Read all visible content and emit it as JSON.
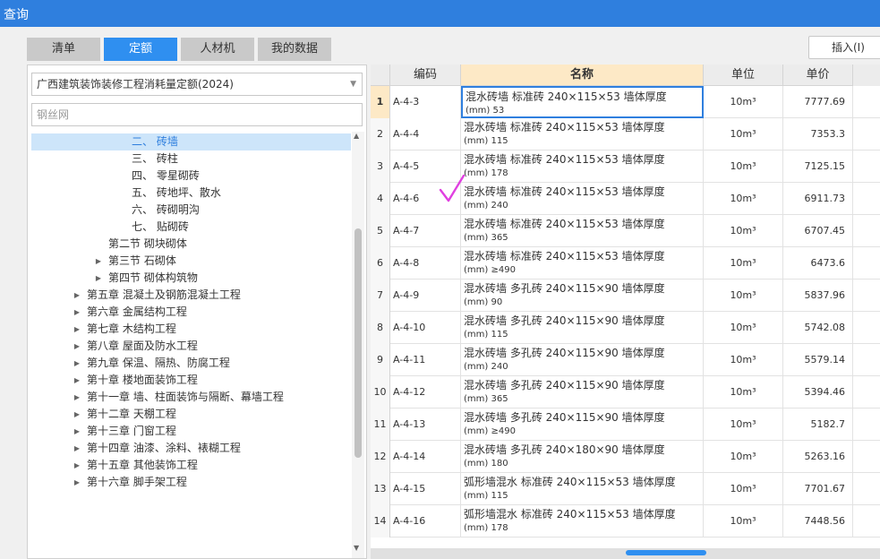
{
  "window": {
    "title": "查询"
  },
  "tabs": [
    {
      "label": "清单",
      "active": false
    },
    {
      "label": "定额",
      "active": true
    },
    {
      "label": "人材机",
      "active": false
    },
    {
      "label": "我的数据",
      "active": false
    }
  ],
  "insert_button": "插入(I)",
  "quota_library": {
    "selected": "广西建筑装饰装修工程消耗量定额(2024)"
  },
  "search": {
    "value": "钢丝网"
  },
  "tree": [
    {
      "label": "二、 砖墙",
      "selected": true,
      "caret": ""
    },
    {
      "label": "三、 砖柱",
      "selected": false,
      "caret": ""
    },
    {
      "label": "四、 零星砌砖",
      "selected": false,
      "caret": ""
    },
    {
      "label": "五、 砖地坪、散水",
      "selected": false,
      "caret": ""
    },
    {
      "label": "六、 砖砌明沟",
      "selected": false,
      "caret": ""
    },
    {
      "label": "七、 贴砌砖",
      "selected": false,
      "caret": ""
    },
    {
      "label": "第二节 砌块砌体",
      "selected": false,
      "caret": ""
    },
    {
      "label": "第三节 石砌体",
      "selected": false,
      "caret": "▶"
    },
    {
      "label": "第四节 砌体构筑物",
      "selected": false,
      "caret": "▶"
    },
    {
      "label": "第五章 混凝土及钢筋混凝土工程",
      "selected": false,
      "caret": "▶"
    },
    {
      "label": "第六章 金属结构工程",
      "selected": false,
      "caret": "▶"
    },
    {
      "label": "第七章 木结构工程",
      "selected": false,
      "caret": "▶"
    },
    {
      "label": "第八章 屋面及防水工程",
      "selected": false,
      "caret": "▶"
    },
    {
      "label": "第九章 保温、隔热、防腐工程",
      "selected": false,
      "caret": "▶"
    },
    {
      "label": "第十章 楼地面装饰工程",
      "selected": false,
      "caret": "▶"
    },
    {
      "label": "第十一章 墙、柱面装饰与隔断、幕墙工程",
      "selected": false,
      "caret": "▶"
    },
    {
      "label": "第十二章 天棚工程",
      "selected": false,
      "caret": "▶"
    },
    {
      "label": "第十三章 门窗工程",
      "selected": false,
      "caret": "▶"
    },
    {
      "label": "第十四章 油漆、涂料、裱糊工程",
      "selected": false,
      "caret": "▶"
    },
    {
      "label": "第十五章 其他装饰工程",
      "selected": false,
      "caret": "▶"
    },
    {
      "label": "第十六章 脚手架工程",
      "selected": false,
      "caret": "▶"
    }
  ],
  "table": {
    "headers": {
      "code": "编码",
      "name": "名称",
      "unit": "单位",
      "price": "单价"
    },
    "rows": [
      {
        "idx": "1",
        "code": "A-4-3",
        "name1": "混水砖墙 标准砖 240×115×53 墙体厚度",
        "name2": "(mm) 53",
        "unit": "10m³",
        "price": "7777.69"
      },
      {
        "idx": "2",
        "code": "A-4-4",
        "name1": "混水砖墙 标准砖 240×115×53 墙体厚度",
        "name2": "(mm) 115",
        "unit": "10m³",
        "price": "7353.3"
      },
      {
        "idx": "3",
        "code": "A-4-5",
        "name1": "混水砖墙 标准砖 240×115×53 墙体厚度",
        "name2": "(mm) 178",
        "unit": "10m³",
        "price": "7125.15"
      },
      {
        "idx": "4",
        "code": "A-4-6",
        "name1": "混水砖墙 标准砖 240×115×53 墙体厚度",
        "name2": "(mm) 240",
        "unit": "10m³",
        "price": "6911.73"
      },
      {
        "idx": "5",
        "code": "A-4-7",
        "name1": "混水砖墙 标准砖 240×115×53 墙体厚度",
        "name2": "(mm) 365",
        "unit": "10m³",
        "price": "6707.45"
      },
      {
        "idx": "6",
        "code": "A-4-8",
        "name1": "混水砖墙 标准砖 240×115×53 墙体厚度",
        "name2": "(mm) ≥490",
        "unit": "10m³",
        "price": "6473.6"
      },
      {
        "idx": "7",
        "code": "A-4-9",
        "name1": "混水砖墙 多孔砖 240×115×90 墙体厚度",
        "name2": "(mm) 90",
        "unit": "10m³",
        "price": "5837.96"
      },
      {
        "idx": "8",
        "code": "A-4-10",
        "name1": "混水砖墙 多孔砖 240×115×90 墙体厚度",
        "name2": "(mm) 115",
        "unit": "10m³",
        "price": "5742.08"
      },
      {
        "idx": "9",
        "code": "A-4-11",
        "name1": "混水砖墙 多孔砖 240×115×90 墙体厚度",
        "name2": "(mm) 240",
        "unit": "10m³",
        "price": "5579.14"
      },
      {
        "idx": "10",
        "code": "A-4-12",
        "name1": "混水砖墙 多孔砖 240×115×90 墙体厚度",
        "name2": "(mm) 365",
        "unit": "10m³",
        "price": "5394.46"
      },
      {
        "idx": "11",
        "code": "A-4-13",
        "name1": "混水砖墙 多孔砖 240×115×90 墙体厚度",
        "name2": "(mm) ≥490",
        "unit": "10m³",
        "price": "5182.7"
      },
      {
        "idx": "12",
        "code": "A-4-14",
        "name1": "混水砖墙 多孔砖 240×180×90 墙体厚度",
        "name2": "(mm) 180",
        "unit": "10m³",
        "price": "5263.16"
      },
      {
        "idx": "13",
        "code": "A-4-15",
        "name1": "弧形墙混水 标准砖 240×115×53 墙体厚度",
        "name2": "(mm) 115",
        "unit": "10m³",
        "price": "7701.67"
      },
      {
        "idx": "14",
        "code": "A-4-16",
        "name1": "弧形墙混水 标准砖 240×115×53 墙体厚度",
        "name2": "(mm) 178",
        "unit": "10m³",
        "price": "7448.56"
      }
    ]
  },
  "colors": {
    "accent": "#2f7fde",
    "tab_active": "#2f8ff0",
    "header_highlight": "#fde9c6",
    "checkmark": "#e040e0"
  }
}
